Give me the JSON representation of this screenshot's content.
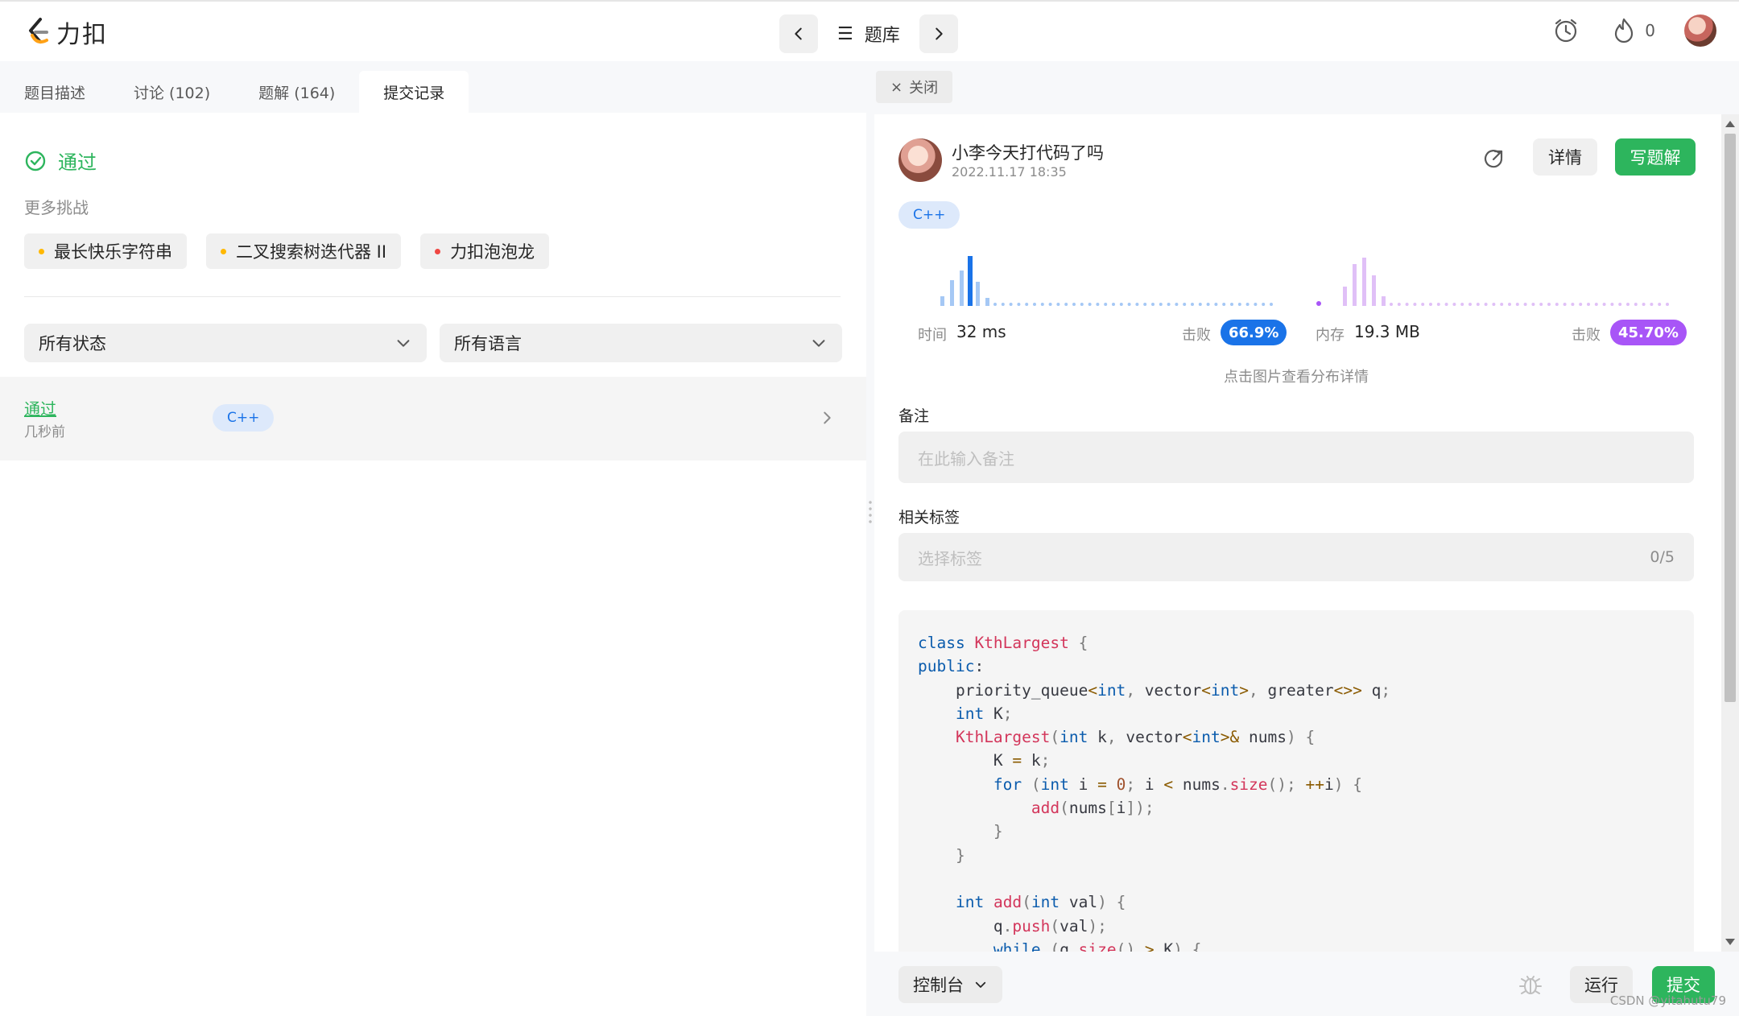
{
  "header": {
    "logo_text": "力扣",
    "problemset_label": "题库",
    "fire_count": "0"
  },
  "left": {
    "tabs": [
      {
        "label": "题目描述"
      },
      {
        "label": "讨论 (102)"
      },
      {
        "label": "题解 (164)"
      },
      {
        "label": "提交记录"
      }
    ],
    "result_status": "通过",
    "more_challenges_label": "更多挑战",
    "challenges": [
      {
        "label": "最长快乐字符串",
        "dot_color": "#ffb800"
      },
      {
        "label": "二叉搜索树迭代器 II",
        "dot_color": "#ffb800"
      },
      {
        "label": "力扣泡泡龙",
        "dot_color": "#ef4743"
      }
    ],
    "filters": {
      "status": "所有状态",
      "language": "所有语言"
    },
    "submission": {
      "status": "通过",
      "time": "几秒前",
      "language": "C++"
    }
  },
  "right": {
    "close_label": "关闭",
    "user": {
      "name": "小李今天打代码了吗",
      "date": "2022.11.17 18:35"
    },
    "buttons": {
      "detail": "详情",
      "write_solution": "写题解"
    },
    "language": "C++",
    "runtime": {
      "label": "时间",
      "value": "32 ms",
      "beat_label": "击败",
      "beat": "66.9%",
      "color": "#1a73e8"
    },
    "memory": {
      "label": "内存",
      "value": "19.3 MB",
      "beat_label": "击败",
      "beat": "45.70%",
      "color": "#a855f7"
    },
    "dist_hint": "点击图片查看分布详情",
    "note": {
      "label": "备注",
      "placeholder": "在此输入备注"
    },
    "tags": {
      "label": "相关标签",
      "placeholder": "选择标签",
      "count": "0/5"
    },
    "code_lines": [
      "class KthLargest {",
      "public:",
      "    priority_queue<int, vector<int>, greater<>> q;",
      "    int K;",
      "    KthLargest(int k, vector<int>& nums) {",
      "        K = k;",
      "        for (int i = 0; i < nums.size(); ++i) {",
      "            add(nums[i]);",
      "        }",
      "    }",
      "",
      "    int add(int val) {",
      "        q.push(val);",
      "        while (q.size() > K) {"
    ]
  },
  "bottom": {
    "console_label": "控制台",
    "run_label": "运行",
    "submit_label": "提交"
  },
  "watermark": "CSDN @yitahutu79",
  "colors": {
    "accent_green": "#2db55d",
    "accent_blue": "#1a73e8",
    "accent_purple": "#a855f7"
  }
}
